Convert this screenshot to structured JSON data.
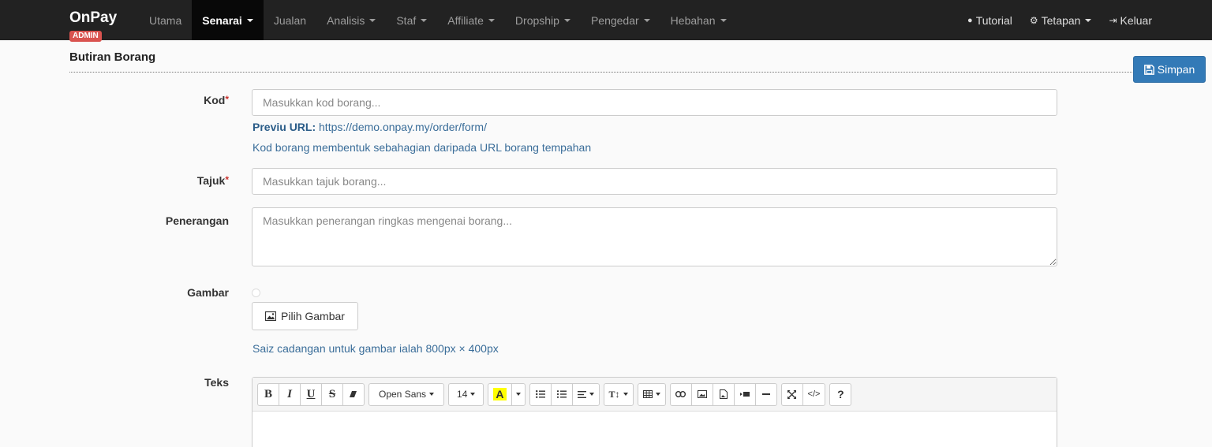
{
  "brand": {
    "name": "OnPay",
    "badge": "ADMIN"
  },
  "nav": {
    "items": [
      {
        "label": "Utama",
        "dropdown": false,
        "active": false
      },
      {
        "label": "Senarai",
        "dropdown": true,
        "active": true
      },
      {
        "label": "Jualan",
        "dropdown": false,
        "active": false
      },
      {
        "label": "Analisis",
        "dropdown": true,
        "active": false
      },
      {
        "label": "Staf",
        "dropdown": true,
        "active": false
      },
      {
        "label": "Affiliate",
        "dropdown": true,
        "active": false
      },
      {
        "label": "Dropship",
        "dropdown": true,
        "active": false
      },
      {
        "label": "Pengedar",
        "dropdown": true,
        "active": false
      },
      {
        "label": "Hebahan",
        "dropdown": true,
        "active": false
      }
    ],
    "right": [
      {
        "label": "Tutorial",
        "icon": "question-circle-icon",
        "dropdown": false
      },
      {
        "label": "Tetapan",
        "icon": "cogs-icon",
        "dropdown": true
      },
      {
        "label": "Keluar",
        "icon": "log-out-icon",
        "dropdown": false
      }
    ]
  },
  "header": {
    "title": "Butiran Borang",
    "save_label": "Simpan"
  },
  "form": {
    "kod": {
      "label": "Kod",
      "placeholder": "Masukkan kod borang...",
      "preview_label": "Previu URL:",
      "preview_url": "https://demo.onpay.my/order/form/",
      "help": "Kod borang membentuk sebahagian daripada URL borang tempahan"
    },
    "tajuk": {
      "label": "Tajuk",
      "placeholder": "Masukkan tajuk borang..."
    },
    "penerangan": {
      "label": "Penerangan",
      "placeholder": "Masukkan penerangan ringkas mengenai borang..."
    },
    "gambar": {
      "label": "Gambar",
      "button": "Pilih Gambar",
      "help": "Saiz cadangan untuk gambar ialah 800px × 400px"
    },
    "teks": {
      "label": "Teks"
    }
  },
  "editor": {
    "font_name": "Open Sans",
    "font_size": "14",
    "highlight_color": "#ffff00",
    "accent": "#337ab7"
  }
}
